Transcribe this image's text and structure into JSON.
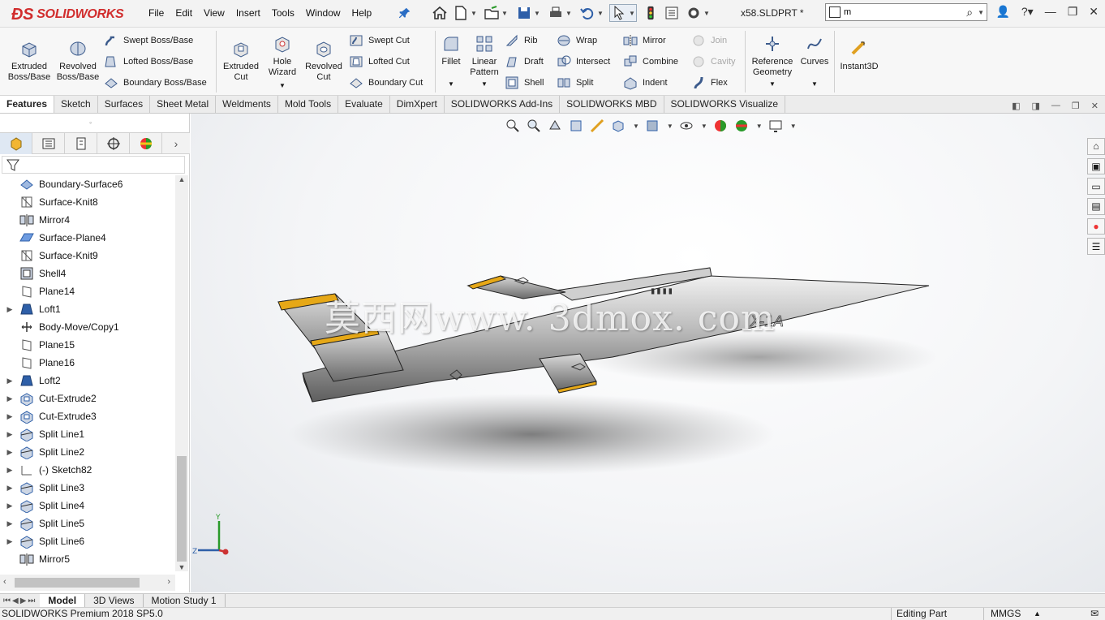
{
  "app": {
    "brand": "SOLIDWORKS",
    "brand_color": "#d12d2d",
    "document_title": "x58.SLDPRT *"
  },
  "menu": [
    "File",
    "Edit",
    "View",
    "Insert",
    "Tools",
    "Window",
    "Help"
  ],
  "search": {
    "value": "m"
  },
  "ribbon": {
    "extruded_boss": "Extruded\nBoss/Base",
    "revolved_boss": "Revolved\nBoss/Base",
    "swept_boss": "Swept Boss/Base",
    "lofted_boss": "Lofted Boss/Base",
    "boundary_boss": "Boundary Boss/Base",
    "extruded_cut": "Extruded\nCut",
    "hole_wizard": "Hole\nWizard",
    "revolved_cut": "Revolved\nCut",
    "swept_cut": "Swept Cut",
    "lofted_cut": "Lofted Cut",
    "boundary_cut": "Boundary Cut",
    "fillet": "Fillet",
    "linear_pattern": "Linear\nPattern",
    "rib": "Rib",
    "draft": "Draft",
    "shell": "Shell",
    "wrap": "Wrap",
    "intersect": "Intersect",
    "split": "Split",
    "mirror": "Mirror",
    "combine": "Combine",
    "indent": "Indent",
    "join": "Join",
    "cavity": "Cavity",
    "flex": "Flex",
    "reference_geometry": "Reference\nGeometry",
    "curves": "Curves",
    "instant3d": "Instant3D"
  },
  "tabs": [
    "Features",
    "Sketch",
    "Surfaces",
    "Sheet Metal",
    "Weldments",
    "Mold Tools",
    "Evaluate",
    "DimXpert",
    "SOLIDWORKS Add-Ins",
    "SOLIDWORKS MBD",
    "SOLIDWORKS Visualize"
  ],
  "tree": [
    {
      "label": "Boundary-Surface6",
      "icon": "boundary-surface-icon",
      "expandable": false
    },
    {
      "label": "Surface-Knit8",
      "icon": "surface-knit-icon",
      "expandable": false
    },
    {
      "label": "Mirror4",
      "icon": "mirror-icon",
      "expandable": false
    },
    {
      "label": "Surface-Plane4",
      "icon": "surface-plane-icon",
      "expandable": false
    },
    {
      "label": "Surface-Knit9",
      "icon": "surface-knit-icon",
      "expandable": false
    },
    {
      "label": "Shell4",
      "icon": "shell-icon",
      "expandable": false
    },
    {
      "label": "Plane14",
      "icon": "plane-icon",
      "expandable": false
    },
    {
      "label": "Loft1",
      "icon": "loft-icon",
      "expandable": true
    },
    {
      "label": "Body-Move/Copy1",
      "icon": "body-move-icon",
      "expandable": false
    },
    {
      "label": "Plane15",
      "icon": "plane-icon",
      "expandable": false
    },
    {
      "label": "Plane16",
      "icon": "plane-icon",
      "expandable": false
    },
    {
      "label": "Loft2",
      "icon": "loft-icon",
      "expandable": true
    },
    {
      "label": "Cut-Extrude2",
      "icon": "cut-extrude-icon",
      "expandable": true
    },
    {
      "label": "Cut-Extrude3",
      "icon": "cut-extrude-icon",
      "expandable": true
    },
    {
      "label": "Split Line1",
      "icon": "split-line-icon",
      "expandable": true
    },
    {
      "label": "Split Line2",
      "icon": "split-line-icon",
      "expandable": true
    },
    {
      "label": "(-) Sketch82",
      "icon": "sketch-icon",
      "expandable": true
    },
    {
      "label": "Split Line3",
      "icon": "split-line-icon",
      "expandable": true
    },
    {
      "label": "Split Line4",
      "icon": "split-line-icon",
      "expandable": true
    },
    {
      "label": "Split Line5",
      "icon": "split-line-icon",
      "expandable": true
    },
    {
      "label": "Split Line6",
      "icon": "split-line-icon",
      "expandable": true
    },
    {
      "label": "Mirror5",
      "icon": "mirror-icon",
      "expandable": false
    }
  ],
  "model": {
    "aircraft_marking": "X-1A",
    "watermark": "莫西网www. 3dmox. com"
  },
  "triad": {
    "y": "Y",
    "z": "Z"
  },
  "bottom_tabs": [
    "Model",
    "3D Views",
    "Motion Study 1"
  ],
  "status": {
    "version": "SOLIDWORKS Premium 2018 SP5.0",
    "mode": "Editing Part",
    "units": "MMGS"
  }
}
